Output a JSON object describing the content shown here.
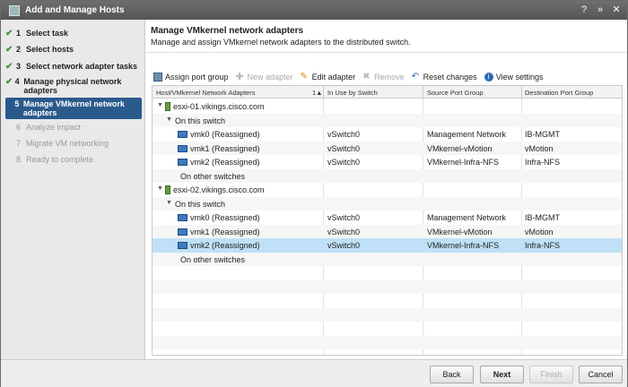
{
  "window": {
    "title": "Add and Manage Hosts"
  },
  "sidebar": {
    "steps": [
      {
        "num": "1",
        "label": "Select task"
      },
      {
        "num": "2",
        "label": "Select hosts"
      },
      {
        "num": "3",
        "label": "Select network adapter tasks"
      },
      {
        "num": "4",
        "label": "Manage physical network adapters"
      },
      {
        "num": "5",
        "label": "Manage VMkernel network adapters"
      },
      {
        "num": "6",
        "label": "Analyze impact"
      },
      {
        "num": "7",
        "label": "Migrate VM networking"
      },
      {
        "num": "8",
        "label": "Ready to complete"
      }
    ]
  },
  "main": {
    "title": "Manage VMkernel network adapters",
    "subtitle": "Manage and assign VMkernel network adapters to the distributed switch."
  },
  "toolbar": {
    "assign": "Assign port group",
    "new": "New adapter",
    "edit": "Edit adapter",
    "remove": "Remove",
    "reset": "Reset changes",
    "view": "View settings"
  },
  "table": {
    "columns": [
      "Host/VMkernel Network Adapters",
      "In Use by Switch",
      "Source Port Group",
      "Destination Port Group"
    ],
    "sort_indicator": "1▲",
    "rows": [
      {
        "host": "esxi-01.vikings.cisco.com"
      },
      {
        "group": "On this switch"
      },
      {
        "adapter": "vmk0 (Reassigned)",
        "switch": "vSwitch0",
        "src": "Management Network",
        "dst": "IB-MGMT"
      },
      {
        "adapter": "vmk1 (Reassigned)",
        "switch": "vSwitch0",
        "src": "VMkernel-vMotion",
        "dst": "vMotion"
      },
      {
        "adapter": "vmk2 (Reassigned)",
        "switch": "vSwitch0",
        "src": "VMkernel-Infra-NFS",
        "dst": "Infra-NFS"
      },
      {
        "group2": "On other switches"
      },
      {
        "host": "esxi-02.vikings.cisco.com"
      },
      {
        "group": "On this switch"
      },
      {
        "adapter": "vmk0 (Reassigned)",
        "switch": "vSwitch0",
        "src": "Management Network",
        "dst": "IB-MGMT"
      },
      {
        "adapter": "vmk1 (Reassigned)",
        "switch": "vSwitch0",
        "src": "VMkernel-vMotion",
        "dst": "vMotion"
      },
      {
        "adapter": "vmk2 (Reassigned)",
        "switch": "vSwitch0",
        "src": "VMkernel-Infra-NFS",
        "dst": "Infra-NFS"
      },
      {
        "group2": "On other switches"
      }
    ]
  },
  "footer": {
    "back": "Back",
    "next": "Next",
    "finish": "Finish",
    "cancel": "Cancel"
  },
  "colors": {
    "selected_row": "#bfe0f6",
    "active_step": "#2a5a8c",
    "titlebar": "#5f5f5f"
  }
}
